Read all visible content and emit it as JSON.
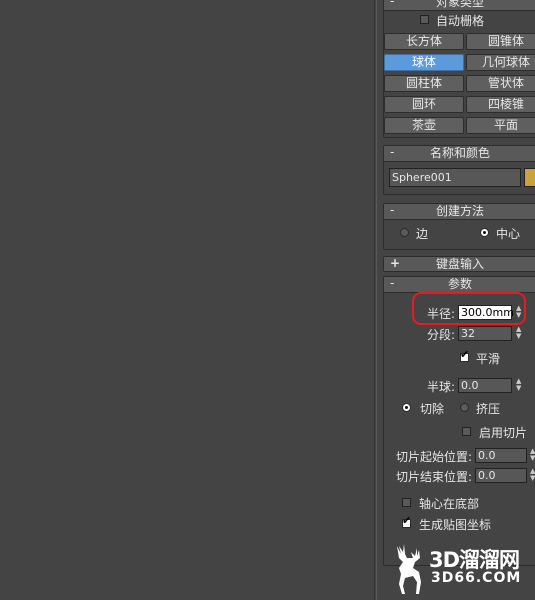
{
  "object_type": {
    "title": "对象类型",
    "collapse": "-",
    "autogrid_label": "自动栅格",
    "buttons": [
      "长方体",
      "圆锥体",
      "球体",
      "几何球体",
      "圆柱体",
      "管状体",
      "圆环",
      "四棱锥",
      "茶壶",
      "平面"
    ],
    "active_button": "球体"
  },
  "name_color": {
    "title": "名称和颜色",
    "collapse": "-",
    "name_value": "Sphere001",
    "swatch_color": "#c8a23a"
  },
  "creation_method": {
    "title": "创建方法",
    "collapse": "-",
    "option_edge": "边",
    "option_center": "中心",
    "selected": "中心"
  },
  "keyboard_entry": {
    "title": "键盘输入",
    "expand": "+"
  },
  "parameters": {
    "title": "参数",
    "collapse": "-",
    "radius_label": "半径:",
    "radius_value": "300.0mm",
    "segments_label": "分段:",
    "segments_value": "32",
    "smooth_label": "平滑",
    "smooth_checked": true,
    "hemisphere_label": "半球:",
    "hemisphere_value": "0.0",
    "chop_label": "切除",
    "squash_label": "挤压",
    "hemi_mode_selected": "切除",
    "slice_on_label": "启用切片",
    "slice_on_checked": false,
    "slice_from_label": "切片起始位置:",
    "slice_from_value": "0.0",
    "slice_to_label": "切片结束位置:",
    "slice_to_value": "0.0",
    "base_to_pivot_label": "轴心在底部",
    "base_to_pivot_checked": false,
    "gen_mapping_label": "生成贴图坐标",
    "gen_mapping_checked": true
  },
  "watermark": {
    "line1": "3D溜溜网",
    "line2": "3D66.COM"
  },
  "colors": {
    "highlight": "#e81c1c",
    "active_button": "#5b9bdc"
  }
}
